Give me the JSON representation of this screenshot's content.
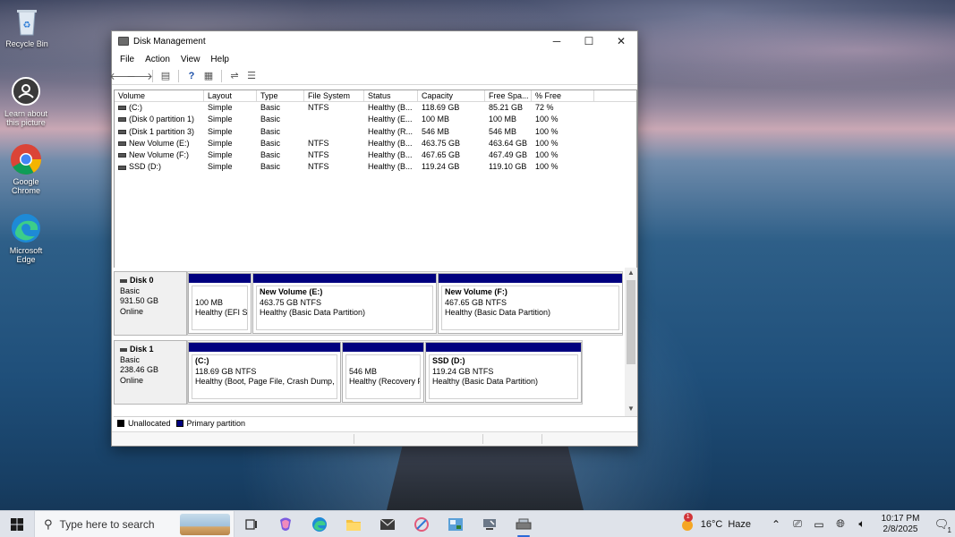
{
  "desktop": {
    "icons": [
      {
        "label": "Recycle Bin"
      },
      {
        "label": "Learn about this picture"
      },
      {
        "label": "Google Chrome"
      },
      {
        "label": "Microsoft Edge"
      }
    ]
  },
  "window": {
    "title": "Disk Management",
    "controls": {
      "minimize": "─",
      "maximize": "☐",
      "close": "✕"
    },
    "menu": [
      "File",
      "Action",
      "View",
      "Help"
    ]
  },
  "volumes": {
    "columns": [
      "Volume",
      "Layout",
      "Type",
      "File System",
      "Status",
      "Capacity",
      "Free Spa...",
      "% Free"
    ],
    "rows": [
      [
        "(C:)",
        "Simple",
        "Basic",
        "NTFS",
        "Healthy (B...",
        "118.69 GB",
        "85.21 GB",
        "72 %"
      ],
      [
        "(Disk 0 partition 1)",
        "Simple",
        "Basic",
        "",
        "Healthy (E...",
        "100 MB",
        "100 MB",
        "100 %"
      ],
      [
        "(Disk 1 partition 3)",
        "Simple",
        "Basic",
        "",
        "Healthy (R...",
        "546 MB",
        "546 MB",
        "100 %"
      ],
      [
        "New Volume (E:)",
        "Simple",
        "Basic",
        "NTFS",
        "Healthy (B...",
        "463.75 GB",
        "463.64 GB",
        "100 %"
      ],
      [
        "New Volume (F:)",
        "Simple",
        "Basic",
        "NTFS",
        "Healthy (B...",
        "467.65 GB",
        "467.49 GB",
        "100 %"
      ],
      [
        "SSD (D:)",
        "Simple",
        "Basic",
        "NTFS",
        "Healthy (B...",
        "119.24 GB",
        "119.10 GB",
        "100 %"
      ]
    ]
  },
  "disks": [
    {
      "name": "Disk 0",
      "type": "Basic",
      "size": "931.50 GB",
      "state": "Online",
      "partitions": [
        {
          "name": "",
          "size": "100 MB",
          "status": "Healthy (EFI Sy"
        },
        {
          "name": "New Volume  (E:)",
          "size": "463.75 GB NTFS",
          "status": "Healthy (Basic Data Partition)"
        },
        {
          "name": "New Volume  (F:)",
          "size": "467.65 GB NTFS",
          "status": "Healthy (Basic Data Partition)"
        }
      ]
    },
    {
      "name": "Disk 1",
      "type": "Basic",
      "size": "238.46 GB",
      "state": "Online",
      "partitions": [
        {
          "name": "(C:)",
          "size": "118.69 GB NTFS",
          "status": "Healthy (Boot, Page File, Crash Dump,"
        },
        {
          "name": "",
          "size": "546 MB",
          "status": "Healthy (Recovery F"
        },
        {
          "name": "SSD  (D:)",
          "size": "119.24 GB NTFS",
          "status": "Healthy (Basic Data Partition)"
        }
      ]
    }
  ],
  "legend": [
    {
      "label": "Unallocated",
      "color": "#000000"
    },
    {
      "label": "Primary partition",
      "color": "#00007f"
    }
  ],
  "taskbar": {
    "search_placeholder": "Type here to search",
    "weather": {
      "temp": "16°C",
      "condition": "Haze"
    },
    "clock": {
      "time": "10:17 PM",
      "date": "2/8/2025"
    },
    "notification_count": "1",
    "weather_badge": "1"
  }
}
